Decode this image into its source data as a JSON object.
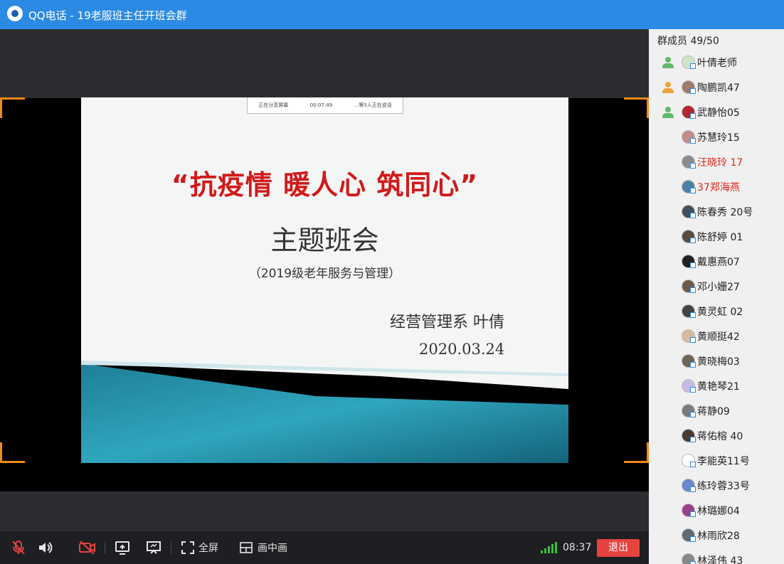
{
  "window": {
    "title": "QQ电话 - 19老服班主任开班会群"
  },
  "slide": {
    "share_status": "正在分享屏幕",
    "share_time": "00:07:49",
    "share_speaker": "...等5人正在说话",
    "title": "“抗疫情 暖人心 筑同心”",
    "subtitle": "主题班会",
    "note": "（2019级老年服务与管理）",
    "author": "经营管理系   叶倩",
    "date": "2020.03.24"
  },
  "sidebar": {
    "member_count": "群成员 49/50",
    "members": [
      {
        "name": "叶倩老师",
        "role": "owner",
        "avatar": "#cfe3c6",
        "highlight": false
      },
      {
        "name": "陶鹏凯47",
        "role": "admin",
        "avatar": "#9e7b6a",
        "highlight": false
      },
      {
        "name": "武静怡05",
        "role": "member-green",
        "avatar": "#b3262d",
        "highlight": false
      },
      {
        "name": "苏慧玲15",
        "role": "",
        "avatar": "#c58a86",
        "highlight": false
      },
      {
        "name": "汪晓玲 17",
        "role": "",
        "avatar": "#8c8c8c",
        "highlight": true
      },
      {
        "name": "37郑海燕",
        "role": "",
        "avatar": "#4d7fa8",
        "highlight": true
      },
      {
        "name": "陈春秀  20号",
        "role": "",
        "avatar": "#3f4f5e",
        "highlight": false
      },
      {
        "name": "陈舒婷 01",
        "role": "",
        "avatar": "#5b4a3f",
        "highlight": false
      },
      {
        "name": "戴惠燕07",
        "role": "",
        "avatar": "#222222",
        "highlight": false
      },
      {
        "name": "邓小姗27",
        "role": "",
        "avatar": "#6d5a4b",
        "highlight": false
      },
      {
        "name": "黄灵虹 02",
        "role": "",
        "avatar": "#444444",
        "highlight": false
      },
      {
        "name": "黄顺挺42",
        "role": "",
        "avatar": "#d9b99b",
        "highlight": false
      },
      {
        "name": "黄晓梅03",
        "role": "",
        "avatar": "#6f6355",
        "highlight": false
      },
      {
        "name": "黄艳琴21",
        "role": "",
        "avatar": "#c9b8e3",
        "highlight": false
      },
      {
        "name": "蒋静09",
        "role": "",
        "avatar": "#7a7a7a",
        "highlight": false
      },
      {
        "name": "蒋佑榕 40",
        "role": "",
        "avatar": "#4b3a30",
        "highlight": false
      },
      {
        "name": "李能英11号",
        "role": "",
        "avatar": "#ffffff",
        "highlight": false
      },
      {
        "name": "练玲蓉33号",
        "role": "",
        "avatar": "#6b86c9",
        "highlight": false
      },
      {
        "name": "林璐娜04",
        "role": "",
        "avatar": "#9b3f8a",
        "highlight": false
      },
      {
        "name": "林雨欣28",
        "role": "",
        "avatar": "#5f6b75",
        "highlight": false
      },
      {
        "name": "林泽伟 43",
        "role": "",
        "avatar": "#888888",
        "highlight": false
      }
    ]
  },
  "toolbar": {
    "fullscreen_label": "全屏",
    "pip_label": "画中画",
    "time": "08:37",
    "exit_label": "退出"
  },
  "colors": {
    "titlebar": "#2b8ae3",
    "accent_orange": "#f08a18",
    "exit_red": "#e64340",
    "name_red": "#e0231a"
  }
}
